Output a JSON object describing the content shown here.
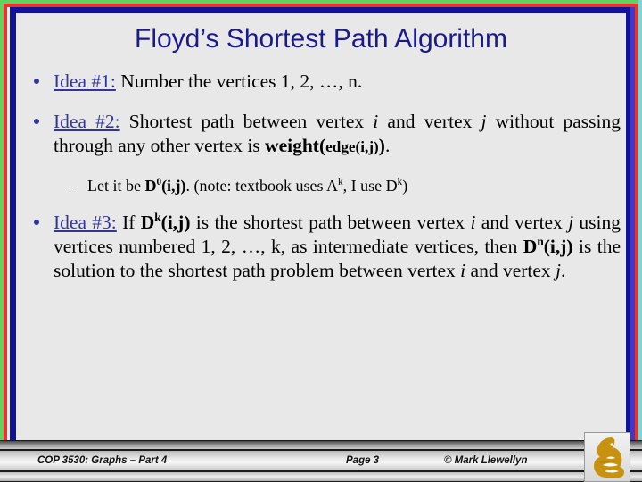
{
  "slide": {
    "title": "Floyd’s Shortest Path Algorithm",
    "background_color": "#e8e8e8",
    "title_color": "#1a1a8c",
    "accent_color": "#33339c",
    "frame_colors": {
      "outer_green": "#5fd35f",
      "red": "#e8342a",
      "navy": "#121294",
      "right_blue": "#3a3ad0",
      "right_teal": "#7fd4d4"
    }
  },
  "bullets": {
    "idea1": {
      "lead": "Idea #1:",
      "text": " Number the vertices 1, 2, …, n."
    },
    "idea2": {
      "lead": "Idea #2:",
      "t1": " Shortest path between vertex ",
      "i1": "i",
      "t2": " and vertex ",
      "i2": "j",
      "t3": " without passing through any other vertex is ",
      "w_open": "weight(",
      "w_inner": "edge(i,j)",
      "w_close": ")",
      "w_period": "."
    },
    "sub1": {
      "dash": "–",
      "t1": "Let it be ",
      "d_bold": "D",
      "d_sup": "0",
      "d_args": "(i,j)",
      "t2": ". (note: textbook uses A",
      "a_sup": "k",
      "t3": ", I use D",
      "d2_sup": "k",
      "t4": ")"
    },
    "idea3": {
      "lead": "Idea #3:",
      "t1": " If ",
      "dk_bold": "D",
      "dk_sup": "k",
      "dk_args": "(i,j)",
      "t2": " is the shortest path between vertex ",
      "i1": "i",
      "t3": " and vertex ",
      "i2": "j",
      "t4": " using vertices numbered 1, 2, …, k, as intermediate vertices, then ",
      "dn_bold": "D",
      "dn_sup": "n",
      "dn_args": "(i,j)",
      "t5": " is the solution to the shortest path problem between vertex ",
      "i3": "i",
      "t6": " and vertex ",
      "i4": "j",
      "t7": "."
    }
  },
  "footer": {
    "course": "COP 3530: Graphs – Part 4",
    "page": "Page 3",
    "copyright": "© Mark Llewellyn",
    "logo_name": "ucf-pegasus-logo",
    "logo_color": "#c89211"
  }
}
